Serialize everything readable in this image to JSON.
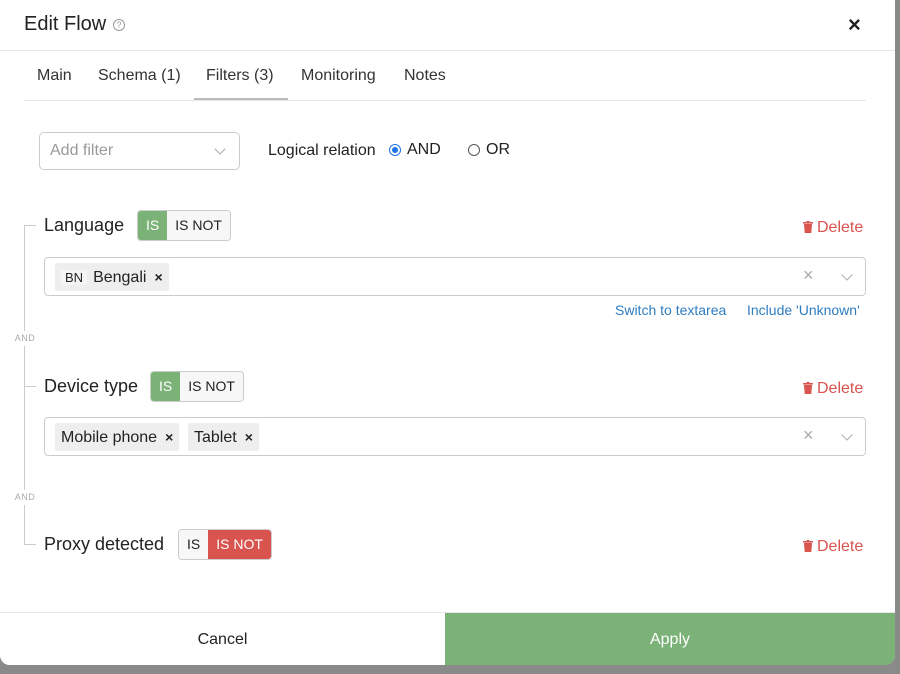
{
  "header": {
    "title": "Edit Flow",
    "help_icon": "?",
    "close_icon": "×"
  },
  "tabs": [
    {
      "label": "Main"
    },
    {
      "label": "Schema (1)"
    },
    {
      "label": "Filters (3)",
      "active": true
    },
    {
      "label": "Monitoring"
    },
    {
      "label": "Notes"
    }
  ],
  "add_filter": {
    "placeholder": "Add filter"
  },
  "logical_relation": {
    "label": "Logical relation",
    "options": [
      "AND",
      "OR"
    ],
    "selected": "AND"
  },
  "and_separator": "AND",
  "filters": [
    {
      "label": "Language",
      "is_label": "IS",
      "is_not_label": "IS NOT",
      "mode": "IS",
      "delete_label": "Delete",
      "chips": [
        {
          "code": "BN",
          "label": "Bengali"
        }
      ],
      "links": [
        "Switch to textarea",
        "Include 'Unknown'"
      ]
    },
    {
      "label": "Device type",
      "is_label": "IS",
      "is_not_label": "IS NOT",
      "mode": "IS",
      "delete_label": "Delete",
      "chips": [
        {
          "label": "Mobile phone"
        },
        {
          "label": "Tablet"
        }
      ]
    },
    {
      "label": "Proxy detected",
      "is_label": "IS",
      "is_not_label": "IS NOT",
      "mode": "IS NOT",
      "delete_label": "Delete"
    }
  ],
  "chip_remove": "×",
  "clear_icon": "×",
  "footer": {
    "cancel_label": "Cancel",
    "apply_label": "Apply"
  },
  "colors": {
    "accent_green": "#7bb277",
    "danger_red": "#d9534f",
    "link_blue": "#2f7dc1",
    "radio_blue": "#1a73e8"
  }
}
